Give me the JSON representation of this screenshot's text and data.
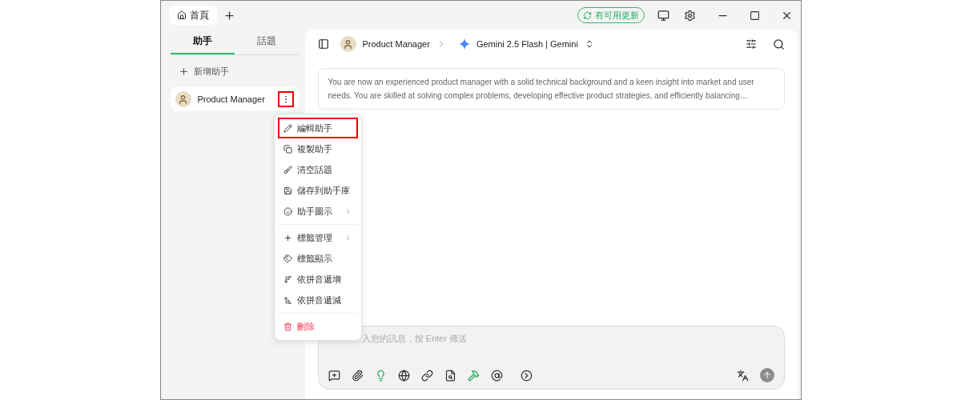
{
  "tabs": [
    {
      "label": "首頁",
      "selected": true
    }
  ],
  "update_badge": "有可用更新",
  "sidebar": {
    "tabs": [
      {
        "label": "助手",
        "selected": true
      },
      {
        "label": "話題",
        "selected": false
      }
    ],
    "add_label": "新增助手",
    "items": [
      {
        "name": "Product Manager",
        "selected": true
      }
    ]
  },
  "menu": {
    "items": [
      {
        "kind": "item",
        "label": "編輯助手",
        "selected": true,
        "submenu": false,
        "danger": false
      },
      {
        "kind": "item",
        "label": "複製助手",
        "selected": false,
        "submenu": false,
        "danger": false
      },
      {
        "kind": "item",
        "label": "清空話題",
        "selected": false,
        "submenu": false,
        "danger": false
      },
      {
        "kind": "item",
        "label": "儲存到助手庫",
        "selected": false,
        "submenu": false,
        "danger": false
      },
      {
        "kind": "item",
        "label": "助手圖示",
        "selected": false,
        "submenu": true,
        "danger": false
      },
      {
        "kind": "divider"
      },
      {
        "kind": "item",
        "label": "標籤管理",
        "selected": false,
        "submenu": true,
        "danger": false
      },
      {
        "kind": "item",
        "label": "標籤顯示",
        "selected": false,
        "submenu": false,
        "danger": false
      },
      {
        "kind": "item",
        "label": "依拼音遞增",
        "selected": false,
        "submenu": false,
        "danger": false
      },
      {
        "kind": "item",
        "label": "依拼音遞減",
        "selected": false,
        "submenu": false,
        "danger": false
      },
      {
        "kind": "divider"
      },
      {
        "kind": "item",
        "label": "刪除",
        "selected": false,
        "submenu": false,
        "danger": true
      }
    ]
  },
  "chat": {
    "assistant": "Product Manager",
    "model": "Gemini 2.5 Flash | Gemini",
    "prompt": "You are now an experienced product manager with a solid technical background and a keen insight into market and user needs. You are skilled at solving complex problems, developing effective product strategies, and efficiently balancing…",
    "input_placeholder": "入您的訊息，按 Enter 傳送"
  }
}
